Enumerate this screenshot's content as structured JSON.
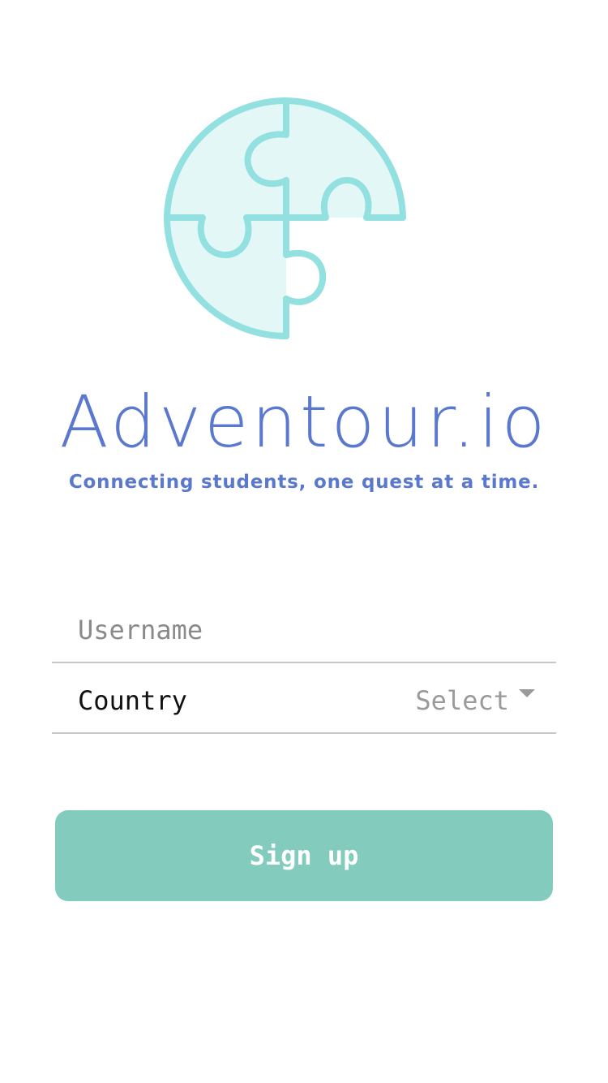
{
  "brand": {
    "name": "Adventour.io",
    "tagline": "Connecting students, one quest at a time.",
    "logo_icon": "puzzle-globe-icon"
  },
  "form": {
    "username": {
      "placeholder": "Username",
      "value": ""
    },
    "country": {
      "label": "Country",
      "selected": "Select",
      "icon": "caret-down-icon"
    }
  },
  "actions": {
    "signup_label": "Sign up"
  },
  "colors": {
    "brand_blue": "#5b78cf",
    "logo_stroke": "#93e0e0",
    "logo_fill": "#e4f7f7",
    "button_bg": "#82cbbd",
    "divider": "#c8c8c8",
    "placeholder": "#8a8a8a"
  }
}
